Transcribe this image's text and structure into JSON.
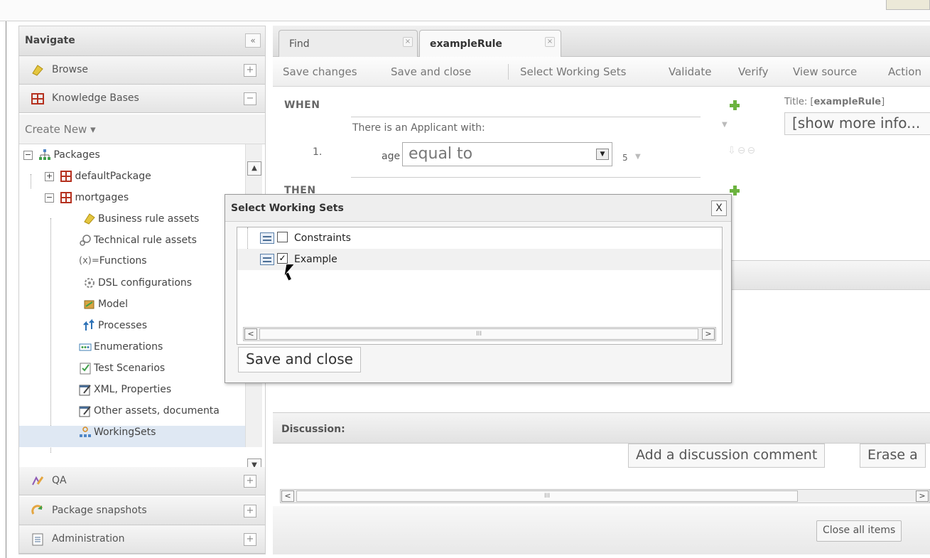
{
  "navigate": {
    "title": "Navigate",
    "collapse": "«",
    "sections": {
      "browse": "Browse",
      "knowledge_bases": "Knowledge Bases",
      "qa": "QA",
      "package_snapshots": "Package snapshots",
      "administration": "Administration"
    },
    "plus": "+",
    "minus": "−",
    "create_new": "Create New ▾",
    "tree": {
      "packages": "Packages",
      "default_package": "defaultPackage",
      "mortgages": "mortgages",
      "items": [
        "Business rule assets",
        "Technical rule assets",
        "Functions",
        "DSL configurations",
        "Model",
        "Processes",
        "Enumerations",
        "Test Scenarios",
        "XML, Properties",
        "Other assets, documenta",
        "WorkingSets"
      ],
      "functions_prefix": "(x)="
    }
  },
  "tabs": [
    {
      "label": "Find",
      "close": "×"
    },
    {
      "label": "exampleRule",
      "close": "×"
    }
  ],
  "toolbar": {
    "save_changes": "Save changes",
    "save_and_close": "Save and close",
    "select_working_sets": "Select Working Sets",
    "validate": "Validate",
    "verify": "Verify",
    "view_source": "View source",
    "action": "Action"
  },
  "editor": {
    "when": "WHEN",
    "then": "THEN",
    "condition_number": "1.",
    "condition_text": "There is an Applicant with:",
    "field": "age",
    "operator": "equal to",
    "value": "5",
    "title_prefix": "Title: [",
    "title_name": "exampleRule",
    "title_suffix": "]",
    "show_more": "[show more info..."
  },
  "discussion": {
    "label": "Discussion:",
    "add_comment": "Add a discussion comment",
    "erase": "Erase a"
  },
  "bottom": {
    "close_all": "Close all items"
  },
  "dialog": {
    "title": "Select Working Sets",
    "close": "X",
    "rows": [
      {
        "label": "Constraints",
        "checked": false,
        "check": ""
      },
      {
        "label": "Example",
        "checked": true,
        "check": "✓"
      }
    ],
    "scroll_thumb": "III",
    "save_and_close": "Save and close"
  },
  "scroll": {
    "left": "<",
    "right": ">",
    "thumb": "III",
    "up": "▲",
    "down": "▼"
  },
  "colors": {
    "accent_green": "#6cb33f",
    "selection": "#dfe8f3",
    "tree_icon_red": "#b5311f"
  }
}
